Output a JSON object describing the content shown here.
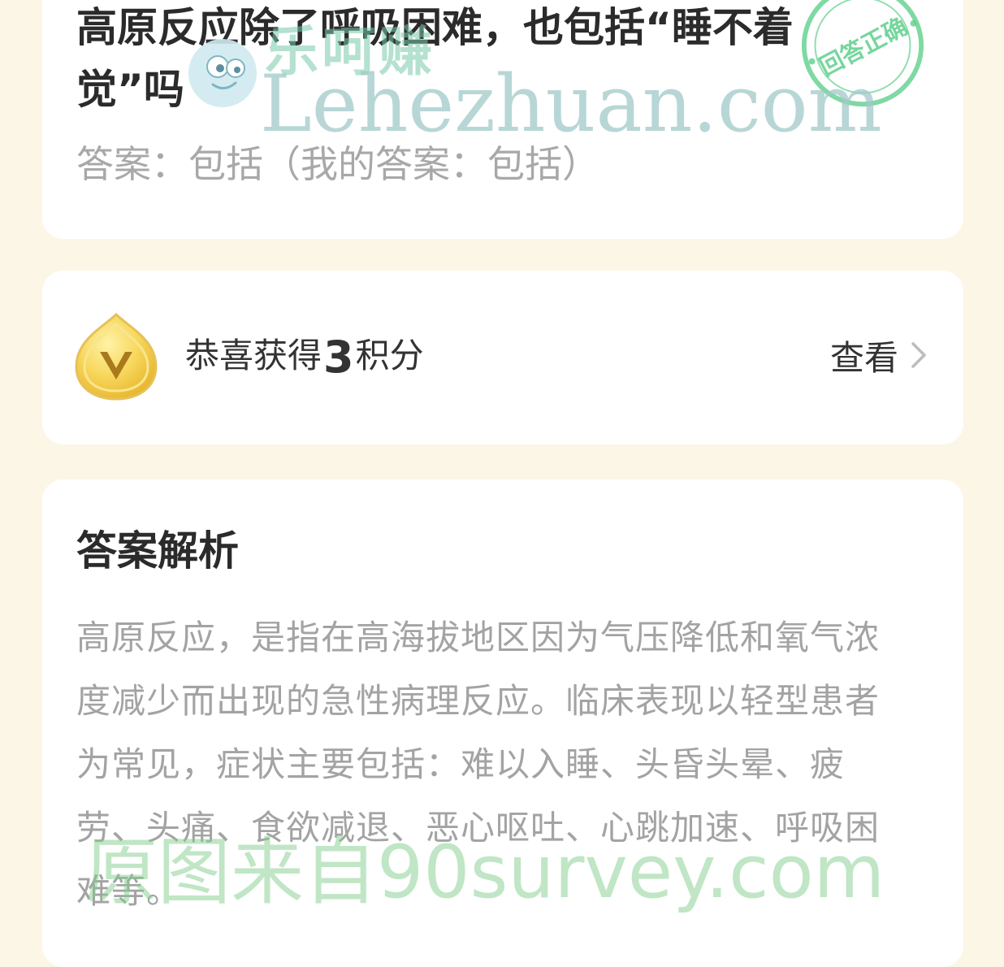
{
  "question": {
    "title": "高原反应除了呼吸困难，也包括“睡不着觉”吗",
    "answer_line": "答案：包括（我的答案：包括）",
    "stamp_text": "回答正确"
  },
  "points": {
    "prefix": "恭喜获得",
    "amount": "3",
    "suffix": "积分",
    "view_label": "查看"
  },
  "analysis": {
    "title": "答案解析",
    "body": "高原反应，是指在高海拔地区因为气压降低和氧气浓度减少而出现的急性病理反应。临床表现以轻型患者为常见，症状主要包括：难以入睡、头昏头晕、疲劳、头痛、食欲减退、恶心呕吐、心跳加速、呼吸困难等。"
  },
  "watermarks": {
    "top_cn": "乐呵赚",
    "top_en": "Lehezhuan.com",
    "bottom": "原图来自90survey.com"
  },
  "icons": {
    "coin": "coin-icon",
    "chevron": "chevron-right-icon",
    "stamp": "correct-stamp-icon",
    "mascot": "mascot-icon"
  },
  "colors": {
    "page_bg": "#fcf6e6",
    "card_bg": "#ffffff",
    "stamp_green": "#5fcf8c",
    "coin_gold": "#f2c94c"
  }
}
